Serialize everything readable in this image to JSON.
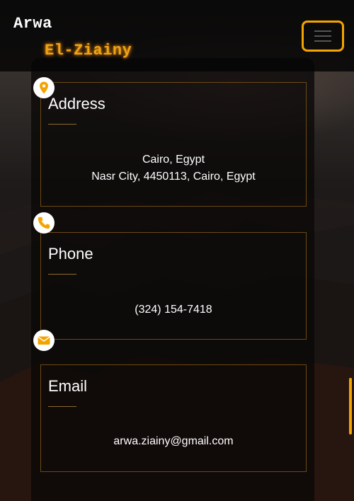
{
  "brand": {
    "first_name": "Arwa",
    "last_name": "El-Ziainy"
  },
  "colors": {
    "accent": "#f5a300",
    "glow": "#f2a212",
    "card_border": "#6b4a12"
  },
  "icons": {
    "address": "map-pin-icon",
    "phone": "phone-icon",
    "email": "envelope-icon",
    "menu": "hamburger-menu-icon"
  },
  "contact": {
    "address": {
      "title": "Address",
      "lines": [
        "Cairo, Egypt",
        "Nasr City, 4450113, Cairo, Egypt"
      ]
    },
    "phone": {
      "title": "Phone",
      "lines": [
        "(324) 154-7418"
      ]
    },
    "email": {
      "title": "Email",
      "lines": [
        "arwa.ziainy@gmail.com"
      ]
    }
  }
}
